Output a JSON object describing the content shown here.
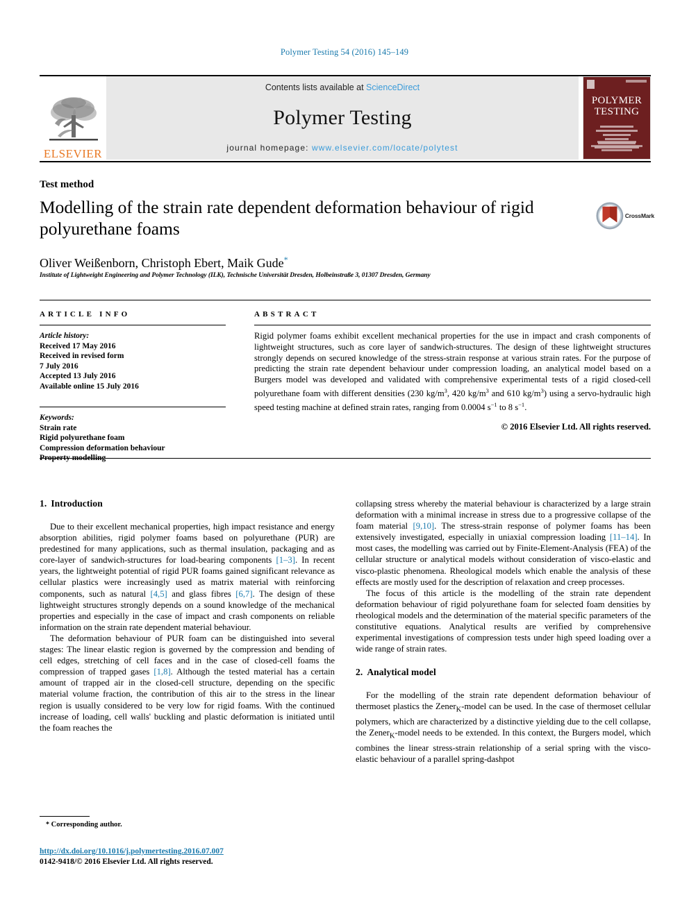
{
  "running_head": "Polymer Testing 54 (2016) 145–149",
  "masthead": {
    "publisher_name": "ELSEVIER",
    "contents_prefix": "Contents lists available at ",
    "contents_link": "ScienceDirect",
    "journal_title": "Polymer Testing",
    "homepage_prefix": "journal homepage: ",
    "homepage_url": "www.elsevier.com/locate/polytest",
    "cover_title_line1": "POLYMER",
    "cover_title_line2": "TESTING"
  },
  "article": {
    "kicker": "Test method",
    "title": "Modelling of the strain rate dependent deformation behaviour of rigid polyurethane foams",
    "crossmark_label": "CrossMark",
    "authors": "Oliver Weißenborn, Christoph Ebert, Maik Gude",
    "affiliation": "Institute of Lightweight Engineering and Polymer Technology (ILK), Technische Universität Dresden, Holbeinstraße 3, 01307 Dresden, Germany"
  },
  "article_info": {
    "heading": "ARTICLE INFO",
    "history_label": "Article history:",
    "history": [
      "Received 17 May 2016",
      "Received in revised form",
      "7 July 2016",
      "Accepted 13 July 2016",
      "Available online 15 July 2016"
    ],
    "keywords_label": "Keywords:",
    "keywords": [
      "Strain rate",
      "Rigid polyurethane foam",
      "Compression deformation behaviour",
      "Property modelling"
    ]
  },
  "abstract": {
    "heading": "ABSTRACT",
    "part1": "Rigid polymer foams exhibit excellent mechanical properties for the use in impact and crash components of lightweight structures, such as core layer of sandwich-structures. The design of these lightweight structures strongly depends on secured knowledge of the stress-strain response at various strain rates. For the purpose of predicting the strain rate dependent behaviour under compression loading, an analytical model based on a Burgers model was developed and validated with comprehensive experimental tests of a rigid closed-cell polyurethane foam with different densities (230 kg/m",
    "sup1": "3",
    "part2": ", 420 kg/m",
    "sup2": "3",
    "part3": " and 610 kg/m",
    "sup3": "3",
    "part4": ") using a servo-hydraulic high speed testing machine at defined strain rates, ranging from 0.0004 s",
    "sup4": "−1",
    "part5": " to 8 s",
    "sup5": "−1",
    "part6": ".",
    "copyright": "© 2016 Elsevier Ltd. All rights reserved."
  },
  "sections": {
    "intro": {
      "number": "1.",
      "title": "Introduction"
    },
    "analytical": {
      "number": "2.",
      "title": "Analytical model"
    }
  },
  "body": {
    "left_p1_a": "Due to their excellent mechanical properties, high impact resistance and energy absorption abilities, rigid polymer foams based on polyurethane (PUR) are predestined for many applications, such as thermal insulation, packaging and as core-layer of sandwich-structures for load-bearing components ",
    "left_p1_ref1": "[1–3]",
    "left_p1_b": ". In recent years, the lightweight potential of rigid PUR foams gained significant relevance as cellular plastics were increasingly used as matrix material with reinforcing components, such as natural ",
    "left_p1_ref2": "[4,5]",
    "left_p1_c": " and glass fibres ",
    "left_p1_ref3": "[6,7]",
    "left_p1_d": ". The design of these lightweight structures strongly depends on a sound knowledge of the mechanical properties and especially in the case of impact and crash components on reliable information on the strain rate dependent material behaviour.",
    "left_p2_a": "The deformation behaviour of PUR foam can be distinguished into several stages: The linear elastic region is governed by the compression and bending of cell edges, stretching of cell faces and in the case of closed-cell foams the compression of trapped gases ",
    "left_p2_ref1": "[1,8]",
    "left_p2_b": ". Although the tested material has a certain amount of trapped air in the closed-cell structure, depending on the specific material volume fraction, the contribution of this air to the stress in the linear region is usually considered to be very low for rigid foams. With the continued increase of loading, cell walls' buckling and plastic deformation is initiated until the foam reaches the",
    "right_p1_a": "collapsing stress whereby the material behaviour is characterized by a large strain deformation with a minimal increase in stress due to a progressive collapse of the foam material ",
    "right_p1_ref1": "[9,10]",
    "right_p1_b": ". The stress-strain response of polymer foams has been extensively investigated, especially in uniaxial compression loading ",
    "right_p1_ref2": "[11–14]",
    "right_p1_c": ". In most cases, the modelling was carried out by Finite-Element-Analysis (FEA) of the cellular structure or analytical models without consideration of visco-elastic and visco-plastic phenomena. Rheological models which enable the analysis of these effects are mostly used for the description of relaxation and creep processes.",
    "right_p2": "The focus of this article is the modelling of the strain rate dependent deformation behaviour of rigid polyurethane foam for selected foam densities by rheological models and the determination of the material specific parameters of the constitutive equations. Analytical results are verified by comprehensive experimental investigations of compression tests under high speed loading over a wide range of strain rates.",
    "right_p3_a": "For the modelling of the strain rate dependent deformation behaviour of thermoset plastics the Zener",
    "right_p3_sub1": "K",
    "right_p3_b": "-model can be used. In the case of thermoset cellular polymers, which are characterized by a distinctive yielding due to the cell collapse, the Zener",
    "right_p3_sub2": "K",
    "right_p3_c": "-model needs to be extended. In this context, the Burgers model, which combines the linear stress-strain relationship of a serial spring with the visco-elastic behaviour of a parallel spring-dashpot"
  },
  "footer": {
    "corresponding_author": "Corresponding author.",
    "doi": "http://dx.doi.org/10.1016/j.polymertesting.2016.07.007",
    "issn_line": "0142-9418/© 2016 Elsevier Ltd. All rights reserved."
  },
  "colors": {
    "link_blue": "#1a7aad",
    "sciencedirect_blue": "#3a9bd9",
    "elsevier_orange": "#e87722",
    "cover_maroon": "#6d1f20"
  }
}
